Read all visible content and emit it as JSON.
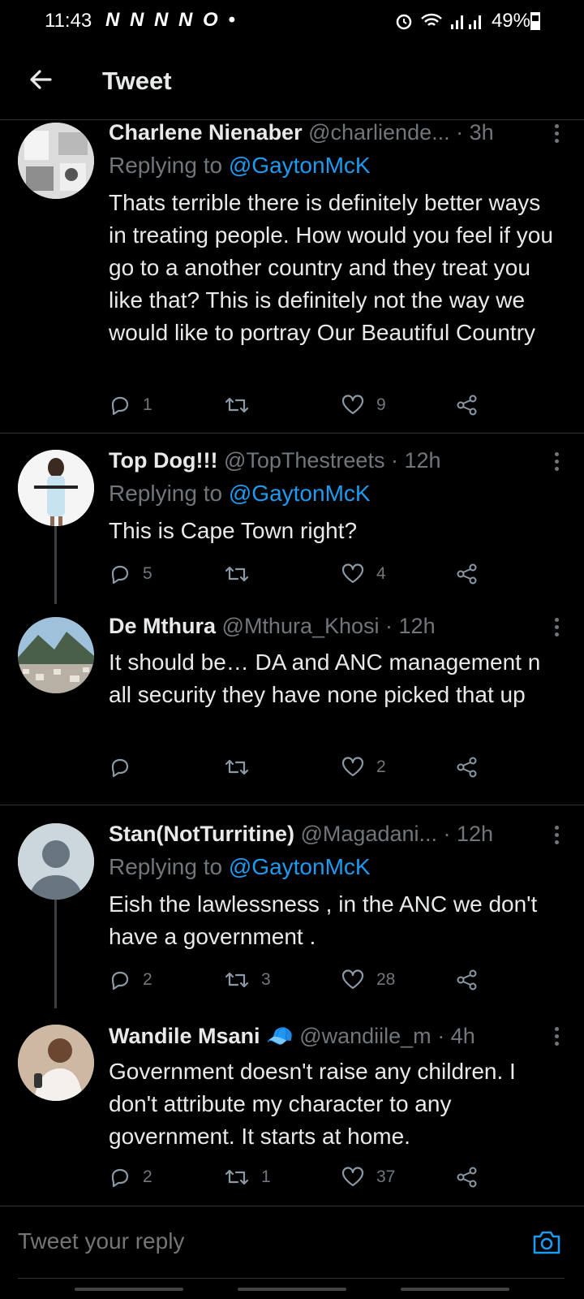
{
  "status": {
    "time": "11:43",
    "notifications": "N N N N O •",
    "battery": "49%"
  },
  "header": {
    "title": "Tweet"
  },
  "tweets": [
    {
      "name": "Charlene Nienaber",
      "handle": "@charliende...",
      "time": "· 3h",
      "replying_label": "Replying to",
      "replying_to": "@GaytonMcK",
      "text": "Thats terrible there is definitely better ways in treating people. How would you feel if you go to a another country and they treat you like that? This is definitely not the way we would like to portray Our Beautiful Country",
      "replies": "1",
      "retweets": "",
      "likes": "9"
    },
    {
      "name": "Top Dog!!!",
      "handle": "@TopThestreets",
      "time": "· 12h",
      "replying_label": "Replying to",
      "replying_to": "@GaytonMcK",
      "text": "This is Cape Town right?",
      "replies": "5",
      "retweets": "",
      "likes": "4"
    },
    {
      "name": "De Mthura",
      "handle": "@Mthura_Khosi",
      "time": "· 12h",
      "text": "It should be… DA and ANC management n all security they have none picked that up",
      "replies": "",
      "retweets": "",
      "likes": "2"
    },
    {
      "name": "Stan(NotTurritine)",
      "handle": "@Magadani...",
      "time": "· 12h",
      "replying_label": "Replying to",
      "replying_to": "@GaytonMcK",
      "text": "Eish the lawlessness , in the ANC we don't have a government .",
      "replies": "2",
      "retweets": "3",
      "likes": "28"
    },
    {
      "name": "Wandile Msani",
      "badge": "🧢",
      "handle": "@wandiile_m",
      "time": "· 4h",
      "text": "Government doesn't raise any children. I don't attribute my character to any government. It starts at home.",
      "replies": "2",
      "retweets": "1",
      "likes": "37"
    }
  ],
  "compose": {
    "placeholder": "Tweet your reply"
  },
  "icons": {
    "back": "arrow-left-icon",
    "more": "more-vertical-icon",
    "reply": "reply-icon",
    "retweet": "retweet-icon",
    "like": "heart-icon",
    "share": "share-icon",
    "camera": "camera-icon"
  },
  "colors": {
    "accent": "#1d9bf0",
    "muted": "#71767b",
    "background": "#000000"
  }
}
